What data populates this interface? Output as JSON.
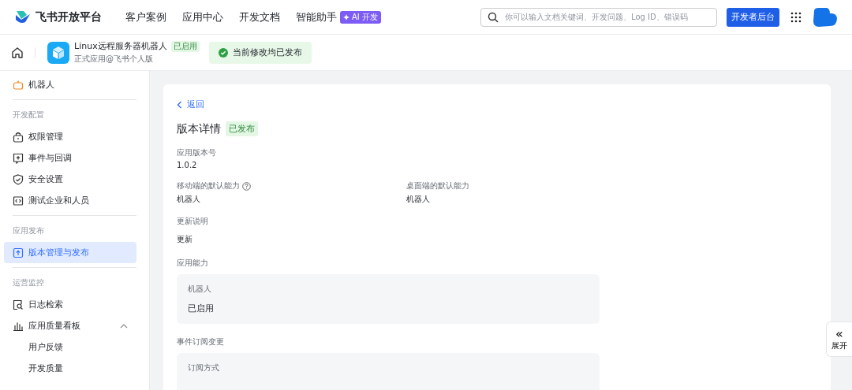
{
  "header": {
    "logo": "飞书开放平台",
    "nav": [
      {
        "label": "客户案例"
      },
      {
        "label": "应用中心"
      },
      {
        "label": "开发文档"
      },
      {
        "label": "智能助手",
        "badge": "AI 开发"
      }
    ],
    "search": {
      "placeholder": "你可以输入文档关键词、开发问题、Log ID、错误码"
    },
    "console_button": "开发者后台"
  },
  "app_bar": {
    "app_name": "Linux远程服务器机器人",
    "app_status": "已启用",
    "subtitle": "正式应用@飞书个人版",
    "notice": "当前修改均已发布"
  },
  "sidebar": {
    "sections": [
      {
        "items": [
          {
            "label": "机器人",
            "selected": false
          }
        ]
      },
      {
        "title": "开发配置",
        "items": [
          {
            "label": "权限管理",
            "selected": false
          },
          {
            "label": "事件与回调",
            "selected": false
          },
          {
            "label": "安全设置",
            "selected": false
          },
          {
            "label": "测试企业和人员",
            "selected": false
          }
        ]
      },
      {
        "title": "应用发布",
        "items": [
          {
            "label": "版本管理与发布",
            "selected": true
          }
        ]
      },
      {
        "title": "运营监控",
        "items": [
          {
            "label": "日志检索",
            "selected": false
          },
          {
            "label": "应用质量看板",
            "selected": false,
            "expanded": true,
            "children": [
              {
                "label": "用户反馈",
                "selected": false
              },
              {
                "label": "开发质量",
                "selected": false
              }
            ]
          }
        ]
      }
    ]
  },
  "detail": {
    "back": "返回",
    "title": "版本详情",
    "status": "已发布",
    "version": {
      "label": "应用版本号",
      "value": "1.0.2"
    },
    "abilities": [
      {
        "label": "移动端的默认能力",
        "help": true,
        "value": "机器人"
      },
      {
        "label": "桌面端的默认能力",
        "help": false,
        "value": "机器人"
      }
    ],
    "notes": {
      "label": "更新说明",
      "value": "更新"
    },
    "panels": [
      {
        "title": "应用能力",
        "rows": [
          {
            "label": "机器人",
            "value": "已启用"
          }
        ]
      },
      {
        "title": "事件订阅变更",
        "rows": [
          {
            "label": "订阅方式"
          }
        ]
      }
    ]
  },
  "expand_button": {
    "icon": "«",
    "label": "展开"
  }
}
